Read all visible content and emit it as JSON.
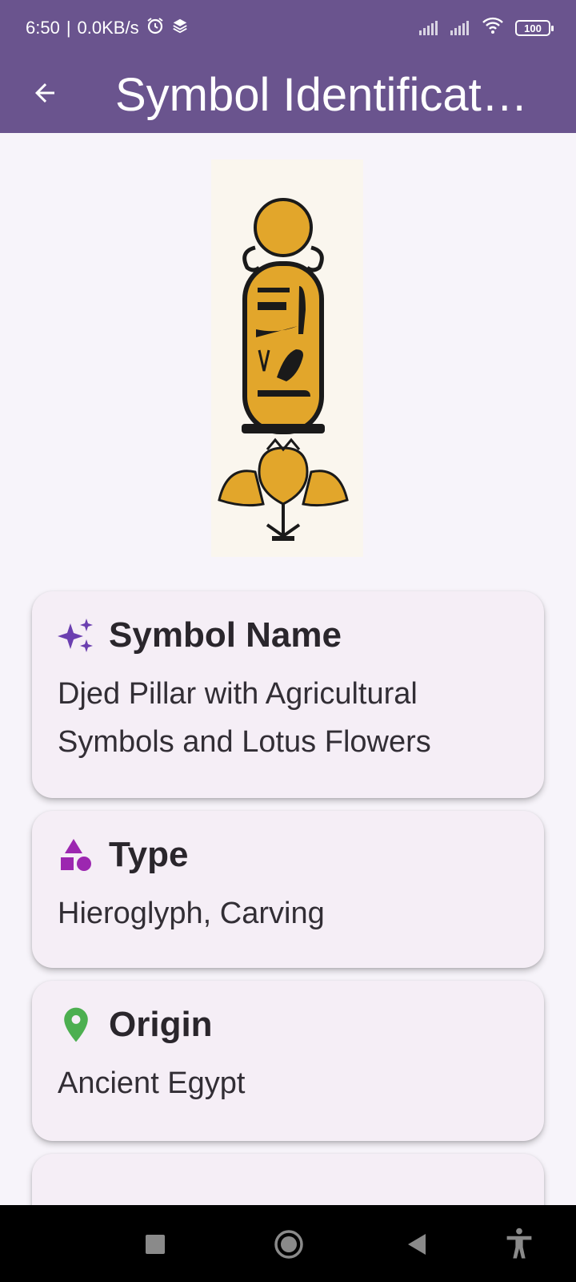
{
  "status_bar": {
    "time": "6:50",
    "separator": "|",
    "speed": "0.0KB/s",
    "battery": "100",
    "icons": [
      "alarm-icon",
      "stack-icon",
      "signal-icon",
      "signal-icon",
      "wifi-icon",
      "battery-icon"
    ]
  },
  "app_bar": {
    "title": "Symbol Identification",
    "back_icon": "arrow-back-icon"
  },
  "image": {
    "subject": "cartouche-with-lotus-flowers"
  },
  "cards": [
    {
      "icon": "sparkles-icon",
      "icon_color": "#6B3FB0",
      "title": "Symbol Name",
      "body": "Djed Pillar with Agricultural Symbols and Lotus Flowers"
    },
    {
      "icon": "shapes-icon",
      "icon_color": "#9C27B0",
      "title": "Type",
      "body": "Hieroglyph, Carving"
    },
    {
      "icon": "location-pin-icon",
      "icon_color": "#4CAF50",
      "title": "Origin",
      "body": "Ancient Egypt"
    }
  ],
  "colors": {
    "primary": "#6A548E",
    "card_bg": "#F5EEF6",
    "page_bg": "#F7F4FA",
    "cartouche_gold": "#E2A62B"
  },
  "nav_bar": {
    "icons": [
      "recents-square-icon",
      "home-circle-icon",
      "back-triangle-icon",
      "accessibility-icon"
    ]
  }
}
